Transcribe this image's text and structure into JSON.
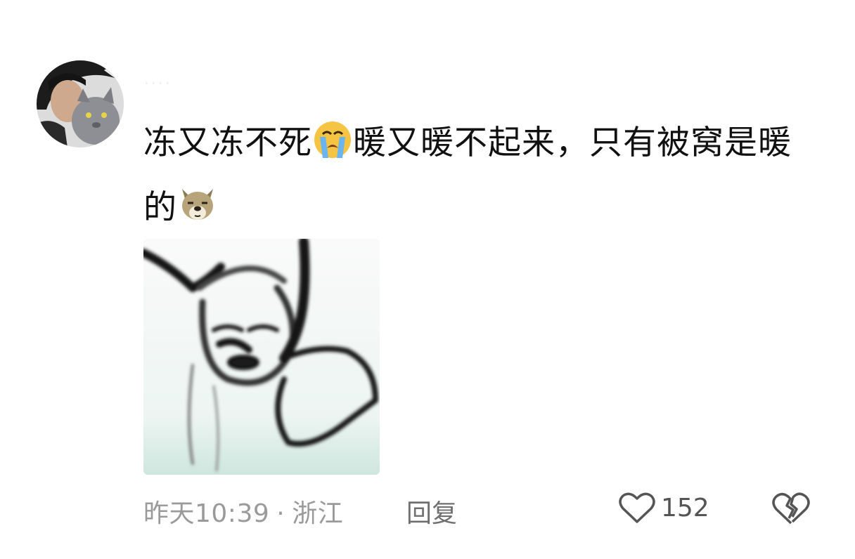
{
  "comment": {
    "username": "····",
    "text_part1": "冻又冻不死",
    "emoji1": "crying-face-emoji",
    "text_part2": "暖又暖不起来，只有被窝是暖的",
    "emoji2": "dog-face-emoji",
    "image": "meme-sticker-image"
  },
  "footer": {
    "time": "昨天10:39",
    "separator": "·",
    "location": "浙江",
    "reply_label": "回复",
    "like_icon": "heart-icon",
    "like_count": "152",
    "dislike_icon": "broken-heart-icon"
  },
  "colors": {
    "text": "#111111",
    "meta": "#9a9a9a",
    "emoji_yellow": "#f6c443",
    "tear_blue": "#6ab4f0"
  }
}
